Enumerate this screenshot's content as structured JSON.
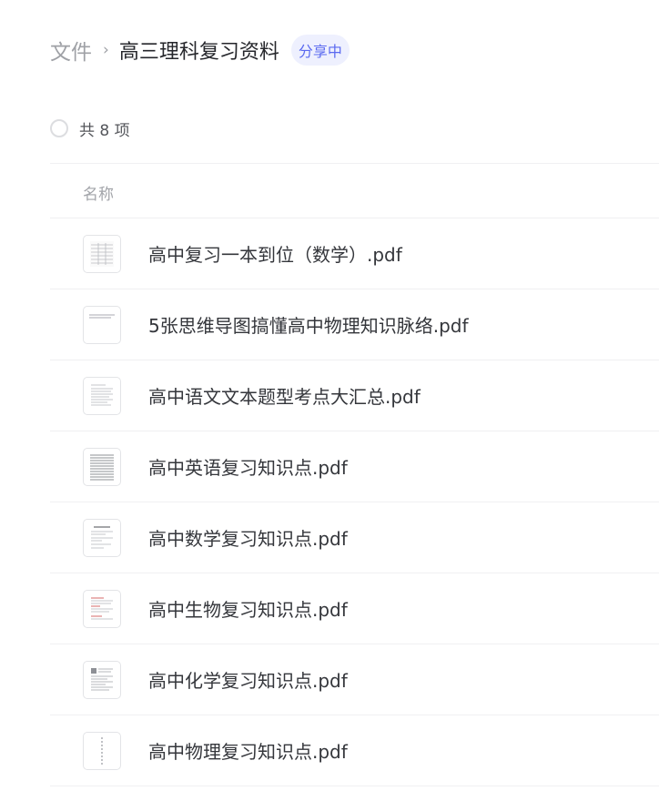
{
  "breadcrumb": {
    "root": "文件",
    "separator": "›",
    "current": "高三理科复习资料",
    "badge": "分享中"
  },
  "summary": {
    "count_text": "共 8 项"
  },
  "table": {
    "column_name": "名称"
  },
  "files": [
    {
      "name": "高中复习一本到位（数学）.pdf",
      "thumb": "table"
    },
    {
      "name": "5张思维导图搞懂高中物理知识脉络.pdf",
      "thumb": "header"
    },
    {
      "name": "高中语文文本题型考点大汇总.pdf",
      "thumb": "text"
    },
    {
      "name": "高中英语复习知识点.pdf",
      "thumb": "dense"
    },
    {
      "name": "高中数学复习知识点.pdf",
      "thumb": "title"
    },
    {
      "name": "高中生物复习知识点.pdf",
      "thumb": "red"
    },
    {
      "name": "高中化学复习知识点.pdf",
      "thumb": "mixed"
    },
    {
      "name": "高中物理复习知识点.pdf",
      "thumb": "column"
    }
  ],
  "colors": {
    "accent": "#5b6af0",
    "badge_bg": "#eef0fe",
    "muted": "#9fa1a6"
  },
  "icons": {
    "select": "radio-circle-icon",
    "file": "pdf-thumbnail-icon"
  }
}
